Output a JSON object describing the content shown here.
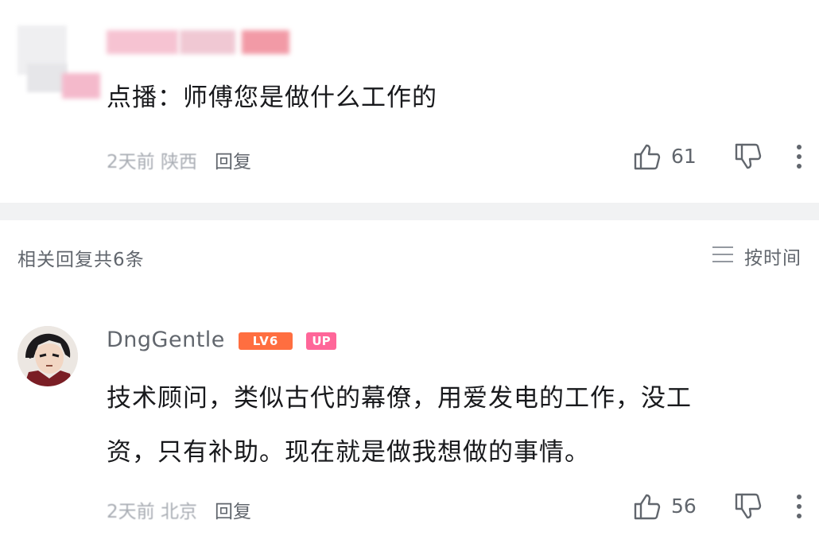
{
  "top_comment": {
    "text": "点播：师傅您是做什么工作的",
    "meta": {
      "time": "2天前",
      "location": "陕西",
      "reply_label": "回复"
    },
    "likes": "61"
  },
  "replies_header": {
    "count_label": "相关回复共6条",
    "sort_label": "按时间"
  },
  "reply": {
    "username": "DngGentle",
    "level_badge": "LV6",
    "up_badge": "UP",
    "text_line1": "技术顾问，类似古代的幕僚，用爱发电的工作，没工",
    "text_line2": "资，只有补助。现在就是做我想做的事情。",
    "meta": {
      "time": "2天前",
      "location": "北京",
      "reply_label": "回复"
    },
    "likes": "56"
  },
  "colors": {
    "level_badge": "#ff6e40",
    "up_badge": "#ff6699",
    "divider": "#f1f2f3",
    "meta_text": "#9499a0"
  },
  "icons": [
    "thumb-up-icon",
    "thumb-down-icon",
    "more-vertical-icon",
    "sort-lines-icon"
  ]
}
